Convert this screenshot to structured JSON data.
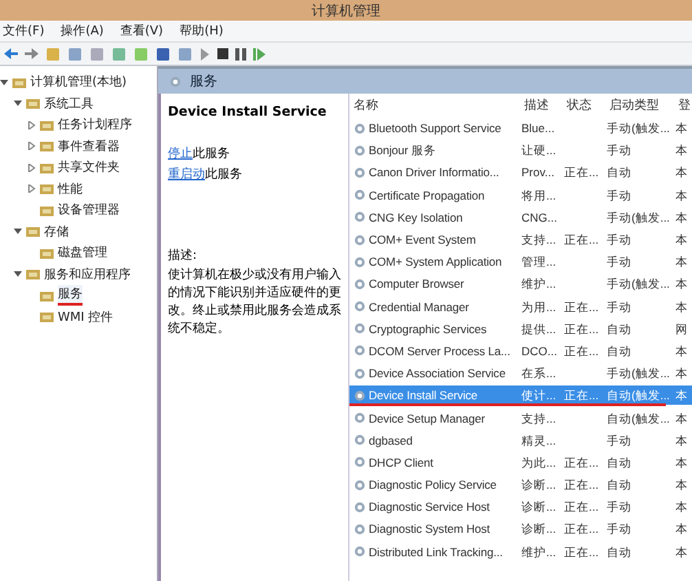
{
  "window": {
    "title": "计算机管理"
  },
  "menu": [
    "文件(F)",
    "操作(A)",
    "查看(V)",
    "帮助(H)"
  ],
  "tree": [
    {
      "label": "计算机管理(本地)",
      "expanded": true,
      "selected": false,
      "children": [
        {
          "label": "系统工具",
          "expanded": true,
          "selected": false,
          "children": [
            {
              "label": "任务计划程序",
              "expanded": false,
              "selected": false
            },
            {
              "label": "事件查看器",
              "expanded": false,
              "selected": false
            },
            {
              "label": "共享文件夹",
              "expanded": false,
              "selected": false
            },
            {
              "label": "性能",
              "expanded": false,
              "selected": false
            },
            {
              "label": "设备管理器",
              "selected": false
            }
          ]
        },
        {
          "label": "存储",
          "expanded": true,
          "selected": false,
          "children": [
            {
              "label": "磁盘管理",
              "selected": false
            }
          ]
        },
        {
          "label": "服务和应用程序",
          "expanded": true,
          "selected": false,
          "children": [
            {
              "label": "服务",
              "selected": true
            },
            {
              "label": "WMI 控件",
              "selected": false
            }
          ]
        }
      ]
    }
  ],
  "panel": {
    "title": "服务"
  },
  "details": {
    "service_name": "Device Install Service",
    "actions": [
      {
        "link": "停止",
        "rest": "此服务"
      },
      {
        "link": "重启动",
        "rest": "此服务"
      }
    ],
    "description_label": "描述:",
    "description": "使计算机在极少或没有用户输入的情况下能识别并适应硬件的更改。终止或禁用此服务会造成系统不稳定。"
  },
  "table": {
    "columns": [
      "名称",
      "描述",
      "状态",
      "启动类型",
      "登"
    ],
    "rows": [
      {
        "cells": [
          "Bluetooth Support Service",
          "Blue...",
          "",
          "手动(触发...",
          "本"
        ],
        "selected": false
      },
      {
        "cells": [
          "Bonjour 服务",
          "让硬...",
          "",
          "手动",
          "本"
        ],
        "selected": false
      },
      {
        "cells": [
          "Canon Driver Informatio...",
          "Prov...",
          "正在...",
          "自动",
          "本"
        ],
        "selected": false
      },
      {
        "cells": [
          "Certificate Propagation",
          "将用...",
          "",
          "手动",
          "本"
        ],
        "selected": false
      },
      {
        "cells": [
          "CNG Key Isolation",
          "CNG...",
          "",
          "手动(触发...",
          "本"
        ],
        "selected": false
      },
      {
        "cells": [
          "COM+ Event System",
          "支持...",
          "正在...",
          "手动",
          "本"
        ],
        "selected": false
      },
      {
        "cells": [
          "COM+ System Application",
          "管理...",
          "",
          "手动",
          "本"
        ],
        "selected": false
      },
      {
        "cells": [
          "Computer Browser",
          "维护...",
          "",
          "手动(触发...",
          "本"
        ],
        "selected": false
      },
      {
        "cells": [
          "Credential Manager",
          "为用...",
          "正在...",
          "手动",
          "本"
        ],
        "selected": false
      },
      {
        "cells": [
          "Cryptographic Services",
          "提供...",
          "正在...",
          "自动",
          "网"
        ],
        "selected": false
      },
      {
        "cells": [
          "DCOM Server Process La...",
          "DCO...",
          "正在...",
          "自动",
          "本"
        ],
        "selected": false
      },
      {
        "cells": [
          "Device Association Service",
          "在系...",
          "",
          "手动(触发...",
          "本"
        ],
        "selected": false
      },
      {
        "cells": [
          "Device Install Service",
          "使计...",
          "正在...",
          "自动(触发...",
          "本"
        ],
        "selected": true
      },
      {
        "cells": [
          "Device Setup Manager",
          "支持...",
          "",
          "自动(触发...",
          "本"
        ],
        "selected": false
      },
      {
        "cells": [
          "dgbased",
          "精灵...",
          "",
          "手动",
          "本"
        ],
        "selected": false
      },
      {
        "cells": [
          "DHCP Client",
          "为此...",
          "正在...",
          "自动",
          "本"
        ],
        "selected": false
      },
      {
        "cells": [
          "Diagnostic Policy Service",
          "诊断...",
          "正在...",
          "自动",
          "本"
        ],
        "selected": false
      },
      {
        "cells": [
          "Diagnostic Service Host",
          "诊断...",
          "正在...",
          "手动",
          "本"
        ],
        "selected": false
      },
      {
        "cells": [
          "Diagnostic System Host",
          "诊断...",
          "正在...",
          "手动",
          "本"
        ],
        "selected": false
      },
      {
        "cells": [
          "Distributed Link Tracking...",
          "维护...",
          "正在...",
          "自动",
          "本"
        ],
        "selected": false
      }
    ]
  }
}
